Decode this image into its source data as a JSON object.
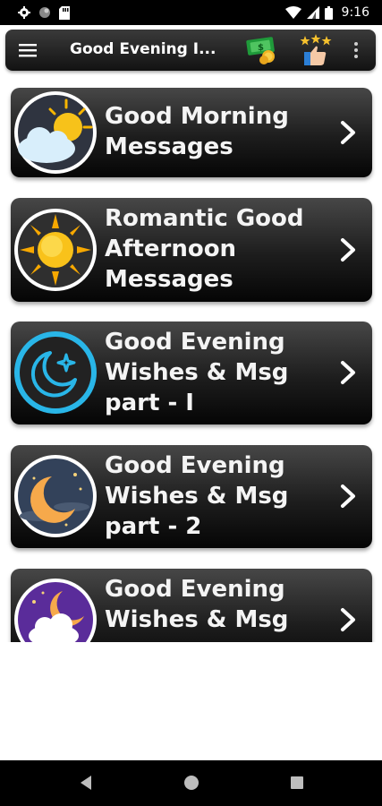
{
  "status_bar": {
    "time": "9:16",
    "left_icons": [
      "gear-icon",
      "circle-icon",
      "sd-card-icon"
    ],
    "right_icons": [
      "wifi-icon",
      "signal-icon",
      "battery-icon"
    ]
  },
  "app_bar": {
    "title": "Good Evening I...",
    "actions": [
      "menu-icon",
      "money-reward-icon",
      "rate-thumbs-up-icon",
      "more-vertical-icon"
    ]
  },
  "menu_items": [
    {
      "label": "Good Morning\nMessages",
      "icon": "morning-sun-cloud-icon"
    },
    {
      "label": "Romantic Good\nAfternoon\nMessages",
      "icon": "afternoon-sun-icon"
    },
    {
      "label": "Good Evening\nWishes & Msg\npart - I",
      "icon": "evening-moon-star-icon"
    },
    {
      "label": "Good Evening\nWishes & Msg\npart - 2",
      "icon": "night-moon-icon"
    },
    {
      "label": "Good Evening\nWishes & Msg",
      "icon": "evening-moon-cloud-icon"
    }
  ],
  "nav_bar": {
    "buttons": [
      "back-icon",
      "home-icon",
      "recents-icon"
    ]
  },
  "colors": {
    "status_bar": "#000000",
    "app_bar": "#1c1c1c",
    "card": "#2a2a2a",
    "card_text": "#f4f4f4",
    "page_background": "#ffffff"
  }
}
